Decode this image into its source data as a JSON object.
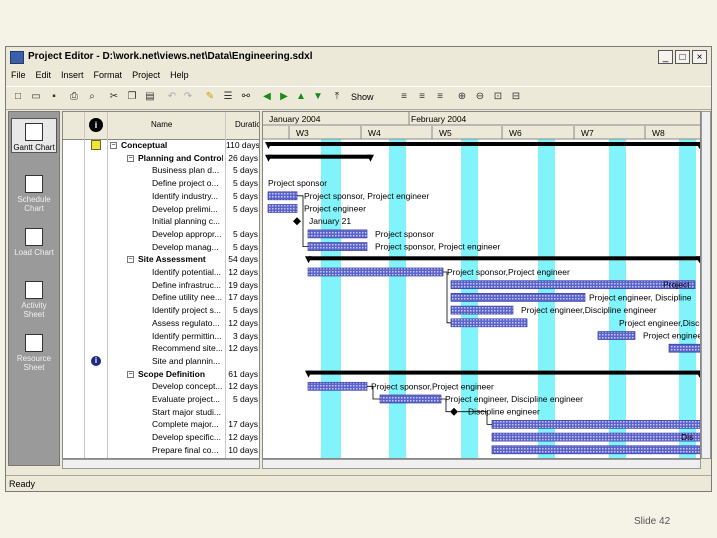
{
  "window": {
    "title": "Project Editor - D:\\work.net\\views.net\\Data\\Engineering.sdxl",
    "controls": [
      "_",
      "□",
      "×"
    ]
  },
  "menu": [
    "File",
    "Edit",
    "Insert",
    "Format",
    "Project",
    "Help"
  ],
  "toolbar": {
    "show_label": "Show"
  },
  "views": [
    {
      "label": "Gantt Chart",
      "selected": true
    },
    {
      "label": "Schedule Chart",
      "selected": false
    },
    {
      "label": "Load Chart",
      "selected": false
    },
    {
      "label": "Activity Sheet",
      "selected": false
    },
    {
      "label": "Resource Sheet",
      "selected": false
    }
  ],
  "grid": {
    "headers": {
      "info": "i",
      "name": "Name",
      "duration": "Duratio"
    },
    "rows": [
      {
        "name": "Conceptual",
        "duration": "110 days",
        "level": 0,
        "summary": true,
        "indicator": "note"
      },
      {
        "name": "Planning and Control",
        "duration": "26 days",
        "level": 1,
        "summary": true,
        "indicator": ""
      },
      {
        "name": "Business plan d...",
        "duration": "5 days",
        "level": 2,
        "summary": false,
        "indicator": ""
      },
      {
        "name": "Define project o...",
        "duration": "5 days",
        "level": 2,
        "summary": false,
        "indicator": ""
      },
      {
        "name": "Identify industry...",
        "duration": "5 days",
        "level": 2,
        "summary": false,
        "indicator": ""
      },
      {
        "name": "Develop prelimi...",
        "duration": "5 days",
        "level": 2,
        "summary": false,
        "indicator": ""
      },
      {
        "name": "Initial planning c...",
        "duration": "",
        "level": 2,
        "summary": false,
        "indicator": ""
      },
      {
        "name": "Develop appropr...",
        "duration": "5 days",
        "level": 2,
        "summary": false,
        "indicator": ""
      },
      {
        "name": "Develop manag...",
        "duration": "5 days",
        "level": 2,
        "summary": false,
        "indicator": ""
      },
      {
        "name": "Site Assessment",
        "duration": "54 days",
        "level": 1,
        "summary": true,
        "indicator": ""
      },
      {
        "name": "Identify potential...",
        "duration": "12 days",
        "level": 2,
        "summary": false,
        "indicator": ""
      },
      {
        "name": "Define infrastruc...",
        "duration": "19 days",
        "level": 2,
        "summary": false,
        "indicator": ""
      },
      {
        "name": "Define utility nee...",
        "duration": "17 days",
        "level": 2,
        "summary": false,
        "indicator": ""
      },
      {
        "name": "Identify project s...",
        "duration": "5 days",
        "level": 2,
        "summary": false,
        "indicator": ""
      },
      {
        "name": "Assess regulato...",
        "duration": "12 days",
        "level": 2,
        "summary": false,
        "indicator": ""
      },
      {
        "name": "Identify permittin...",
        "duration": "3 days",
        "level": 2,
        "summary": false,
        "indicator": ""
      },
      {
        "name": "Recommend site...",
        "duration": "12 days",
        "level": 2,
        "summary": false,
        "indicator": ""
      },
      {
        "name": "Site and plannin...",
        "duration": "",
        "level": 2,
        "summary": false,
        "indicator": "info"
      },
      {
        "name": "Scope Definition",
        "duration": "61 days",
        "level": 1,
        "summary": true,
        "indicator": ""
      },
      {
        "name": "Develop concept...",
        "duration": "12 days",
        "level": 2,
        "summary": false,
        "indicator": ""
      },
      {
        "name": "Evaluate project...",
        "duration": "5 days",
        "level": 2,
        "summary": false,
        "indicator": ""
      },
      {
        "name": "Start major studi...",
        "duration": "",
        "level": 2,
        "summary": false,
        "indicator": ""
      },
      {
        "name": "Complete major...",
        "duration": "17 days",
        "level": 2,
        "summary": false,
        "indicator": ""
      },
      {
        "name": "Develop specific...",
        "duration": "12 days",
        "level": 2,
        "summary": false,
        "indicator": ""
      },
      {
        "name": "Prepare final co...",
        "duration": "10 days",
        "level": 2,
        "summary": false,
        "indicator": ""
      },
      {
        "name": "",
        "duration": "5 days",
        "level": 2,
        "summary": false,
        "indicator": ""
      }
    ]
  },
  "gantt": {
    "months": [
      "January 2004",
      "February 2004"
    ],
    "weeks": [
      "W3",
      "W4",
      "W5",
      "W6",
      "W7",
      "W8"
    ],
    "bar_labels": [
      "Project sponsor",
      "Project sponsor, Project engineer",
      "Project engineer",
      "January 21",
      "Project sponsor",
      "Project sponsor, Project engineer",
      "Project sponsor,Project engineer",
      "Project",
      "Project engineer, Discipline",
      "Project engineer,Discipline engineer",
      "Project engineer,Discipline",
      "Project engineer",
      "Project sponsor,Project engineer",
      "Project engineer, Discipline engineer",
      "Discipline engineer",
      "Dis"
    ],
    "colors": {
      "weekend": "#80f4fa",
      "bar": "#5b63c9",
      "summary": "#000000"
    }
  },
  "status_bar": {
    "text": "Ready"
  },
  "footer": {
    "slide": "Slide  42"
  }
}
